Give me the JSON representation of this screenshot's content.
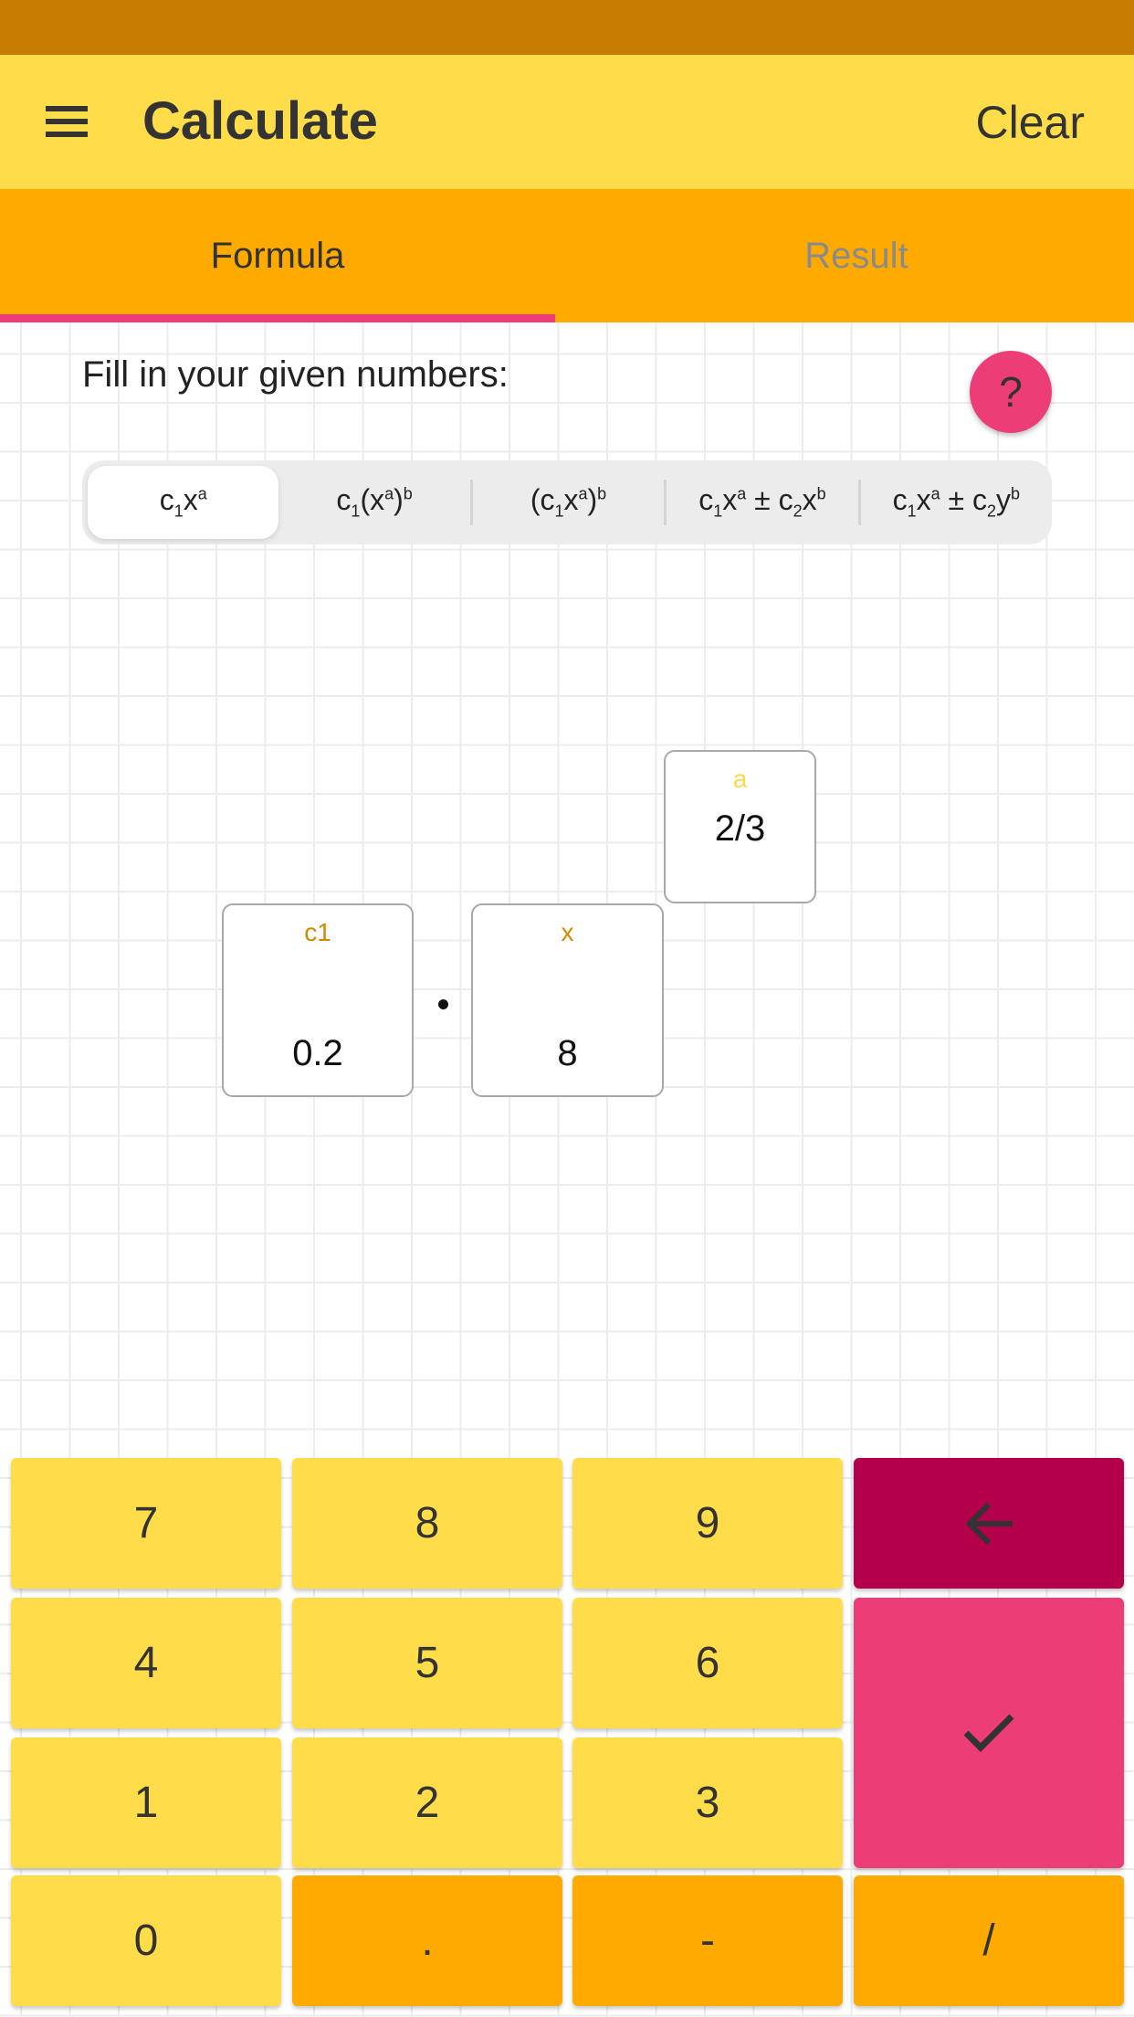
{
  "app_bar": {
    "title": "Calculate",
    "menu_icon": "hamburger-menu-icon",
    "clear_label": "Clear"
  },
  "tabs": [
    {
      "label": "Formula",
      "selected": true
    },
    {
      "label": "Result",
      "selected": false
    }
  ],
  "main": {
    "instruction": "Fill in your given numbers:",
    "help_label": "?",
    "formula_options": [
      {
        "id": "c1xa",
        "label": "c₁xᵃ",
        "selected": true
      },
      {
        "id": "c1xab",
        "label": "c₁(xᵃ)ᵇ",
        "selected": false
      },
      {
        "id": "c1xa_b",
        "label": "(c₁xᵃ)ᵇ",
        "selected": false
      },
      {
        "id": "c1xa_pm_c2xb",
        "label": "c₁xᵃ ± c₂xᵇ",
        "selected": false
      },
      {
        "id": "c1xa_pm_c2yb",
        "label": "c₁xᵃ ± c₂yᵇ",
        "selected": false
      }
    ],
    "fields": {
      "c1": {
        "label": "c1",
        "value": "0.2"
      },
      "x": {
        "label": "x",
        "value": "8"
      },
      "a": {
        "label": "a",
        "value": "2/3"
      }
    },
    "operator": "·"
  },
  "keypad": {
    "keys": [
      {
        "label": "7",
        "type": "digit"
      },
      {
        "label": "8",
        "type": "digit"
      },
      {
        "label": "9",
        "type": "digit"
      },
      {
        "label": "backspace",
        "icon": "arrow-left-icon",
        "type": "action"
      },
      {
        "label": "4",
        "type": "digit"
      },
      {
        "label": "5",
        "type": "digit"
      },
      {
        "label": "6",
        "type": "digit"
      },
      {
        "label": "confirm",
        "icon": "checkmark-icon",
        "type": "action"
      },
      {
        "label": "1",
        "type": "digit"
      },
      {
        "label": "2",
        "type": "digit"
      },
      {
        "label": "3",
        "type": "digit"
      },
      {
        "label": "0",
        "type": "digit"
      },
      {
        "label": ".",
        "type": "symbol"
      },
      {
        "label": "-",
        "type": "symbol"
      },
      {
        "label": "/",
        "type": "symbol"
      }
    ]
  },
  "colors": {
    "status_bar": "#c67c00",
    "app_bar": "#ffdd4a",
    "tab_bar": "#ffaa00",
    "accent_pink": "#ed3d77",
    "backspace": "#b4004a",
    "label_orange": "#d08a00",
    "label_yellow": "#ffd84a"
  }
}
